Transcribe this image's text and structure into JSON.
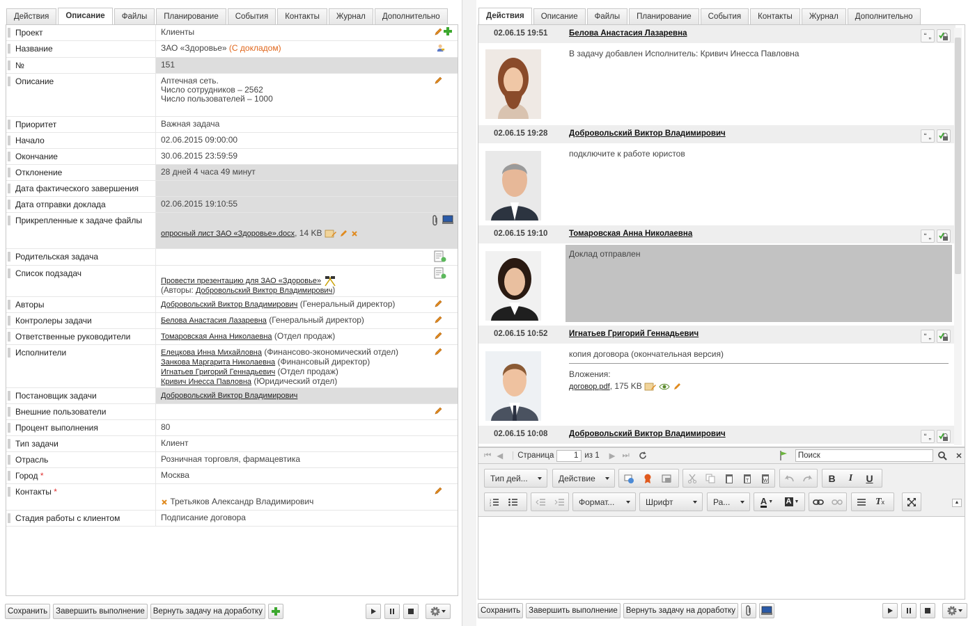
{
  "left": {
    "tabs": [
      "Действия",
      "Описание",
      "Файлы",
      "Планирование",
      "События",
      "Контакты",
      "Журнал",
      "Дополнительно"
    ],
    "active_tab": "Описание",
    "fields": {
      "project": {
        "label": "Проект",
        "value": "Клиенты"
      },
      "name": {
        "label": "Название",
        "value": "ЗАО «Здоровье»",
        "note": "(С докладом)"
      },
      "number": {
        "label": "№",
        "value": "151"
      },
      "description": {
        "label": "Описание",
        "lines": [
          "Аптечная сеть.",
          "Число сотрудников – 2562",
          "Число пользователей – 1000"
        ]
      },
      "priority": {
        "label": "Приоритет",
        "value": "Важная задача"
      },
      "start": {
        "label": "Начало",
        "value": "02.06.2015 09:00:00"
      },
      "end": {
        "label": "Окончание",
        "value": "30.06.2015 23:59:59"
      },
      "deviation": {
        "label": "Отклонение",
        "value": "28 дней 4 часа 49 минут"
      },
      "actual_end": {
        "label": "Дата фактического завершения",
        "value": ""
      },
      "report_sent": {
        "label": "Дата отправки доклада",
        "value": "02.06.2015 19:10:55"
      },
      "files": {
        "label": "Прикрепленные к задаче файлы",
        "file_name": "опросный лист ЗАО «Здоровье».docx",
        "file_size": ", 14 KB"
      },
      "parent": {
        "label": "Родительская задача",
        "value": ""
      },
      "subtasks": {
        "label": "Список подзадач",
        "link": "Провести презентацию для ЗАО «Здоровье»",
        "authors_prefix": "(Авторы: ",
        "author": "Добровольский Виктор Владимирович",
        "authors_suffix": ")"
      },
      "authors": {
        "label": "Авторы",
        "person": "Добровольский Виктор Владимирович",
        "role": " (Генеральный директор)"
      },
      "controllers": {
        "label": "Контролеры задачи",
        "person": "Белова Анастасия Лазаревна",
        "role": " (Генеральный директор)"
      },
      "managers": {
        "label": "Ответственные руководители",
        "person": "Томаровская Анна Николаевна",
        "role": " (Отдел продаж)"
      },
      "executors": {
        "label": "Исполнители",
        "items": [
          {
            "person": "Елецкова Инна Михайловна",
            "role": " (Финансово-экономический отдел)"
          },
          {
            "person": "Занкова Маргарита Николаевна",
            "role": " (Финансовый директор)"
          },
          {
            "person": "Игнатьев Григорий Геннадьевич",
            "role": " (Отдел продаж)"
          },
          {
            "person": "Кривич Инесса Павловна",
            "role": " (Юридический отдел)"
          }
        ]
      },
      "setter": {
        "label": "Постановщик задачи",
        "person": "Добровольский Виктор Владимирович"
      },
      "external": {
        "label": "Внешние пользователи",
        "value": ""
      },
      "percent": {
        "label": "Процент выполнения",
        "value": "80"
      },
      "task_type": {
        "label": "Тип задачи",
        "value": "Клиент"
      },
      "industry": {
        "label": "Отрасль",
        "value": "Розничная торговля, фармацевтика"
      },
      "city": {
        "label": "Город",
        "required": "*",
        "value": "Москва"
      },
      "contacts": {
        "label": "Контакты",
        "required": "*",
        "value": "Третьяков Александр Владимирович"
      },
      "stage": {
        "label": "Стадия работы с клиентом",
        "value": "Подписание договора"
      }
    },
    "buttons": {
      "save": "Сохранить",
      "finish": "Завершить выполнение",
      "return": "Вернуть задачу на доработку"
    }
  },
  "right": {
    "tabs": [
      "Действия",
      "Описание",
      "Файлы",
      "Планирование",
      "События",
      "Контакты",
      "Журнал",
      "Дополнительно"
    ],
    "active_tab": "Действия",
    "entries": [
      {
        "time": "02.06.15 19:51",
        "author": "Белова Анастасия Лазаревна",
        "text": "В задачу добавлен Исполнитель: Кривич Инесса Павловна"
      },
      {
        "time": "02.06.15 19:28",
        "author": "Добровольский Виктор Владимирович",
        "text": "подключите к работе юристов"
      },
      {
        "time": "02.06.15 19:10",
        "author": "Томаровская Анна Николаевна",
        "text": "Доклад отправлен"
      },
      {
        "time": "02.06.15 10:52",
        "author": "Игнатьев Григорий Геннадьевич",
        "text": "копия договора (окончательная версия)",
        "attach_label": "Вложения:",
        "attach_file": "договор.pdf",
        "attach_size": ", 175 KB"
      },
      {
        "time": "02.06.15 10:08",
        "author": "Добровольский Виктор Владимирович",
        "text": ""
      }
    ],
    "pager": {
      "page_label": "Страница",
      "page": "1",
      "of": "из 1",
      "search_placeholder": "Поиск"
    },
    "toolbar": {
      "action_type": "Тип дей...",
      "action": "Действие",
      "format": "Формат...",
      "font": "Шрифт",
      "size": "Ра..."
    },
    "buttons": {
      "save": "Сохранить",
      "finish": "Завершить выполнение",
      "return": "Вернуть задачу на доработку"
    }
  }
}
